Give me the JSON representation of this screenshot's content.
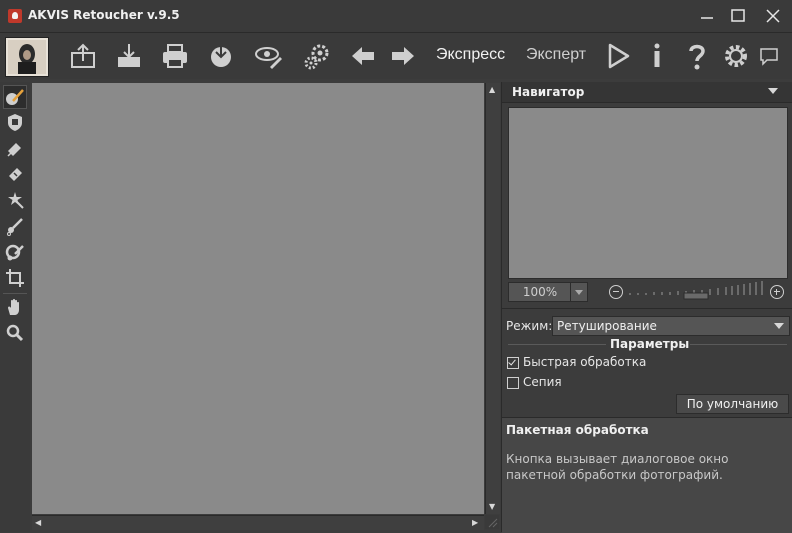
{
  "window": {
    "title": "AKVIS Retoucher v.9.5",
    "controls": [
      "minimize",
      "maximize",
      "close"
    ]
  },
  "toolbar": {
    "buttons": [
      {
        "name": "open-image-icon"
      },
      {
        "name": "save-image-icon"
      },
      {
        "name": "print-icon"
      },
      {
        "name": "share-icon"
      },
      {
        "name": "preferences-eye-icon"
      },
      {
        "name": "batch-gears-icon"
      },
      {
        "name": "undo-arrow-icon"
      },
      {
        "name": "redo-arrow-icon"
      }
    ],
    "mode_express": "Экспресс",
    "mode_expert": "Эксперт",
    "right_buttons": [
      "run-icon",
      "info-icon",
      "help-icon",
      "settings-icon",
      "comment-icon"
    ]
  },
  "tools": [
    "retouch-brush-icon",
    "selection-mask-icon",
    "eraser-icon",
    "patch-icon",
    "magic-wand-icon",
    "clone-stamp-icon",
    "chameleon-icon",
    "crop-icon",
    "hand-icon",
    "zoom-icon"
  ],
  "navigator": {
    "title": "Навигатор",
    "zoom": "100%"
  },
  "settings": {
    "mode_label": "Режим:",
    "mode_value": "Ретуширование",
    "params_title": "Параметры",
    "fast_processing_label": "Быстрая обработка",
    "fast_processing_checked": true,
    "sepia_label": "Сепия",
    "sepia_checked": false,
    "default_button": "По умолчанию"
  },
  "batch": {
    "title": "Пакетная обработка",
    "description": "Кнопка вызывает диалоговое окно пакетной обработки фотографий."
  },
  "colors": {
    "background": "#3c3c3c",
    "canvas": "#8a8a8a",
    "icon": "#cfcfcf"
  }
}
